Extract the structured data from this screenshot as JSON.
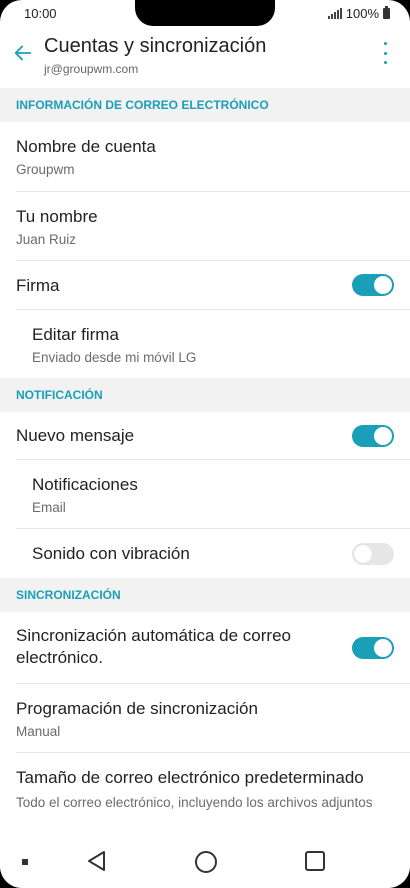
{
  "status": {
    "time": "10:00",
    "battery": "100%"
  },
  "header": {
    "title": "Cuentas y sincronización",
    "subtitle": "jr@groupwm.com"
  },
  "sections": [
    {
      "title": "INFORMACIÓN DE CORREO ELECTRÓNICO",
      "items": [
        {
          "primary": "Nombre de cuenta",
          "secondary": "Groupwm"
        },
        {
          "primary": "Tu nombre",
          "secondary": "Juan Ruiz"
        },
        {
          "primary": "Firma",
          "toggle": "on"
        },
        {
          "primary": "Editar firma",
          "secondary": "Enviado desde mi móvil LG"
        }
      ]
    },
    {
      "title": "NOTIFICACIÓN",
      "items": [
        {
          "primary": "Nuevo mensaje",
          "toggle": "on"
        },
        {
          "primary": "Notificaciones",
          "secondary": "Email"
        },
        {
          "primary": "Sonido con vibración",
          "toggle": "off"
        }
      ]
    },
    {
      "title": "SINCRONIZACIÓN",
      "items": [
        {
          "primary": "Sincronización automática de correo electrónico.",
          "toggle": "on"
        },
        {
          "primary": "Programación de sincronización",
          "secondary": "Manual"
        },
        {
          "primary": "Tamaño de correo electrónico predeterminado",
          "secondary": "Todo el correo electrónico, incluyendo los archivos adjuntos"
        }
      ]
    }
  ],
  "colors": {
    "accent": "#1a9fb8",
    "section_bg": "#f2f2f2",
    "toggle_off": "#e6e6e6"
  },
  "icons": {
    "back": "arrow-left-icon",
    "more": "more-vertical-icon"
  }
}
